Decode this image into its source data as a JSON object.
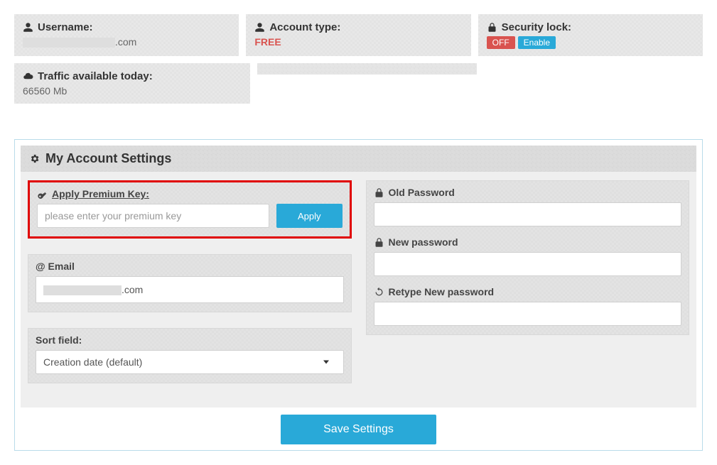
{
  "top": {
    "username_label": "Username:",
    "username_suffix": ".com",
    "account_type_label": "Account type:",
    "account_type_value": "FREE",
    "security_lock_label": "Security lock:",
    "security_off": "OFF",
    "security_enable": "Enable",
    "traffic_label": "Traffic available today:",
    "traffic_value": "66560 Mb"
  },
  "main": {
    "title": "My Account Settings",
    "premium": {
      "label": "Apply Premium Key:",
      "placeholder": "please enter your premium key",
      "apply": "Apply"
    },
    "email": {
      "label": "@ Email",
      "value_suffix": ".com"
    },
    "sort": {
      "label": "Sort field:",
      "selected": "Creation date (default)"
    },
    "pw": {
      "old": "Old Password",
      "new": "New password",
      "retype": "Retype New password"
    },
    "save": "Save Settings"
  }
}
